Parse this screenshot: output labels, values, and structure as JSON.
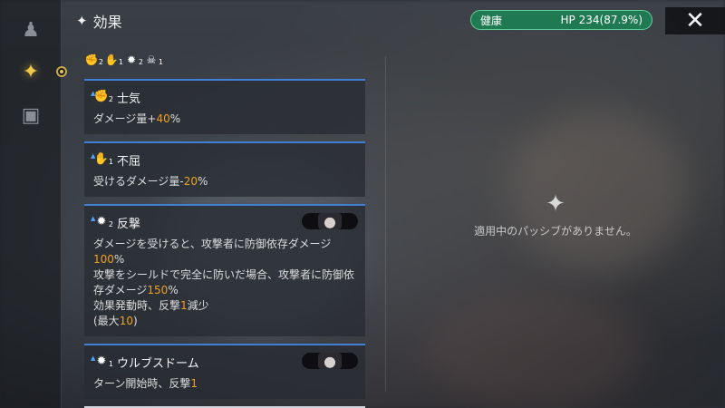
{
  "header": {
    "title": "効果",
    "title_icon": "sparkle-icon"
  },
  "hp": {
    "label": "健康",
    "value": "HP 234(87.9%)",
    "color": "#1f7a52"
  },
  "close": {
    "icon": "close-icon",
    "glyph": "✕"
  },
  "rail": {
    "items": [
      {
        "icon": "party-icon",
        "glyph": "♟"
      },
      {
        "icon": "sparkle-icon",
        "glyph": "✦"
      },
      {
        "icon": "cards-icon",
        "glyph": "▣"
      }
    ]
  },
  "summary": [
    {
      "icon": "morale-icon",
      "glyph": "✊",
      "count": "2"
    },
    {
      "icon": "unyielding-icon",
      "glyph": "✋",
      "count": "1"
    },
    {
      "icon": "counter-icon",
      "glyph": "✹",
      "count": "2"
    },
    {
      "icon": "skull-icon",
      "glyph": "☠",
      "count": "1"
    }
  ],
  "effects": [
    {
      "name": "士気",
      "glyph": "✊",
      "stack": "2",
      "desc_parts": [
        {
          "t": "ダメージ量+"
        },
        {
          "t": "40",
          "hl": true
        },
        {
          "t": "%"
        }
      ],
      "portrait": false
    },
    {
      "name": "不屈",
      "glyph": "✋",
      "stack": "1",
      "desc_parts": [
        {
          "t": "受けるダメージ量-"
        },
        {
          "t": "20",
          "hl": true
        },
        {
          "t": "%"
        }
      ],
      "portrait": false
    },
    {
      "name": "反撃",
      "glyph": "✹",
      "stack": "2",
      "desc_parts": [
        {
          "t": "ダメージを受けると、攻撃者に防御依存ダメージ"
        },
        {
          "t": "100",
          "hl": true
        },
        {
          "t": "%"
        },
        {
          "br": true
        },
        {
          "t": "攻撃をシールドで完全に防いだ場合、攻撃者に防御依存ダメージ"
        },
        {
          "t": "150",
          "hl": true
        },
        {
          "t": "%"
        },
        {
          "br": true
        },
        {
          "t": "効果発動時、反撃"
        },
        {
          "t": "1",
          "hl": true
        },
        {
          "t": "減少"
        },
        {
          "br": true
        },
        {
          "t": "(最大"
        },
        {
          "t": "10",
          "hl": true
        },
        {
          "t": ")"
        }
      ],
      "portrait": true
    },
    {
      "name": "ウルブスドーム",
      "glyph": "✹",
      "stack": "1",
      "desc_parts": [
        {
          "t": "ターン開始時、反撃"
        },
        {
          "t": "1",
          "hl": true
        }
      ],
      "portrait": true
    }
  ],
  "empty_state": {
    "icon": "sparkle-icon",
    "glyph": "✦",
    "message": "適用中のパッシブがありません。"
  },
  "colors": {
    "accent": "#3f7fd6",
    "highlight": "#f0a020",
    "active": "#f2c84b"
  }
}
